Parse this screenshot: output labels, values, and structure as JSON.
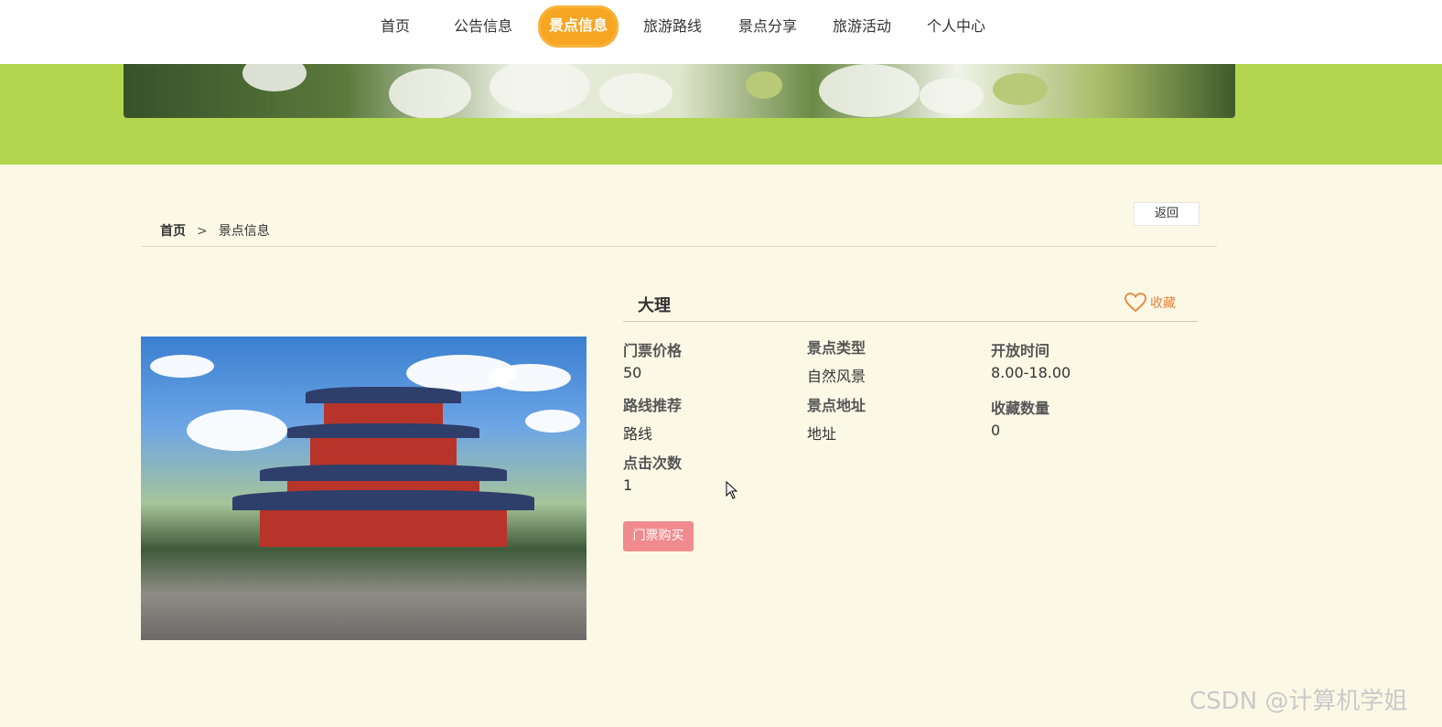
{
  "nav": {
    "items": [
      {
        "label": "首页"
      },
      {
        "label": "公告信息"
      },
      {
        "label": "景点信息"
      },
      {
        "label": "旅游路线"
      },
      {
        "label": "景点分享"
      },
      {
        "label": "旅游活动"
      },
      {
        "label": "个人中心"
      }
    ],
    "active_color": "#f6a623"
  },
  "breadcrumb": {
    "home": "首页",
    "separator": ">",
    "current": "景点信息"
  },
  "back_label": "返回",
  "detail": {
    "title": "大理",
    "favorite_label": "收藏",
    "fields": {
      "ticket_price_label": "门票价格",
      "ticket_price": "50",
      "type_label": "景点类型",
      "type": "自然风景",
      "open_time_label": "开放时间",
      "open_time": "8.00-18.00",
      "route_label": "路线推荐",
      "route": "路线",
      "address_label": "景点地址",
      "address": "地址",
      "fav_count_label": "收藏数量",
      "fav_count": "0",
      "clicks_label": "点击次数",
      "clicks": "1"
    },
    "buy_label": "门票购买"
  },
  "watermark": "CSDN @计算机学姐",
  "colors": {
    "banner": "#b2d74f",
    "background": "#fbf9e6",
    "buy": "#f08a8e",
    "favorite": "#e8823a"
  }
}
